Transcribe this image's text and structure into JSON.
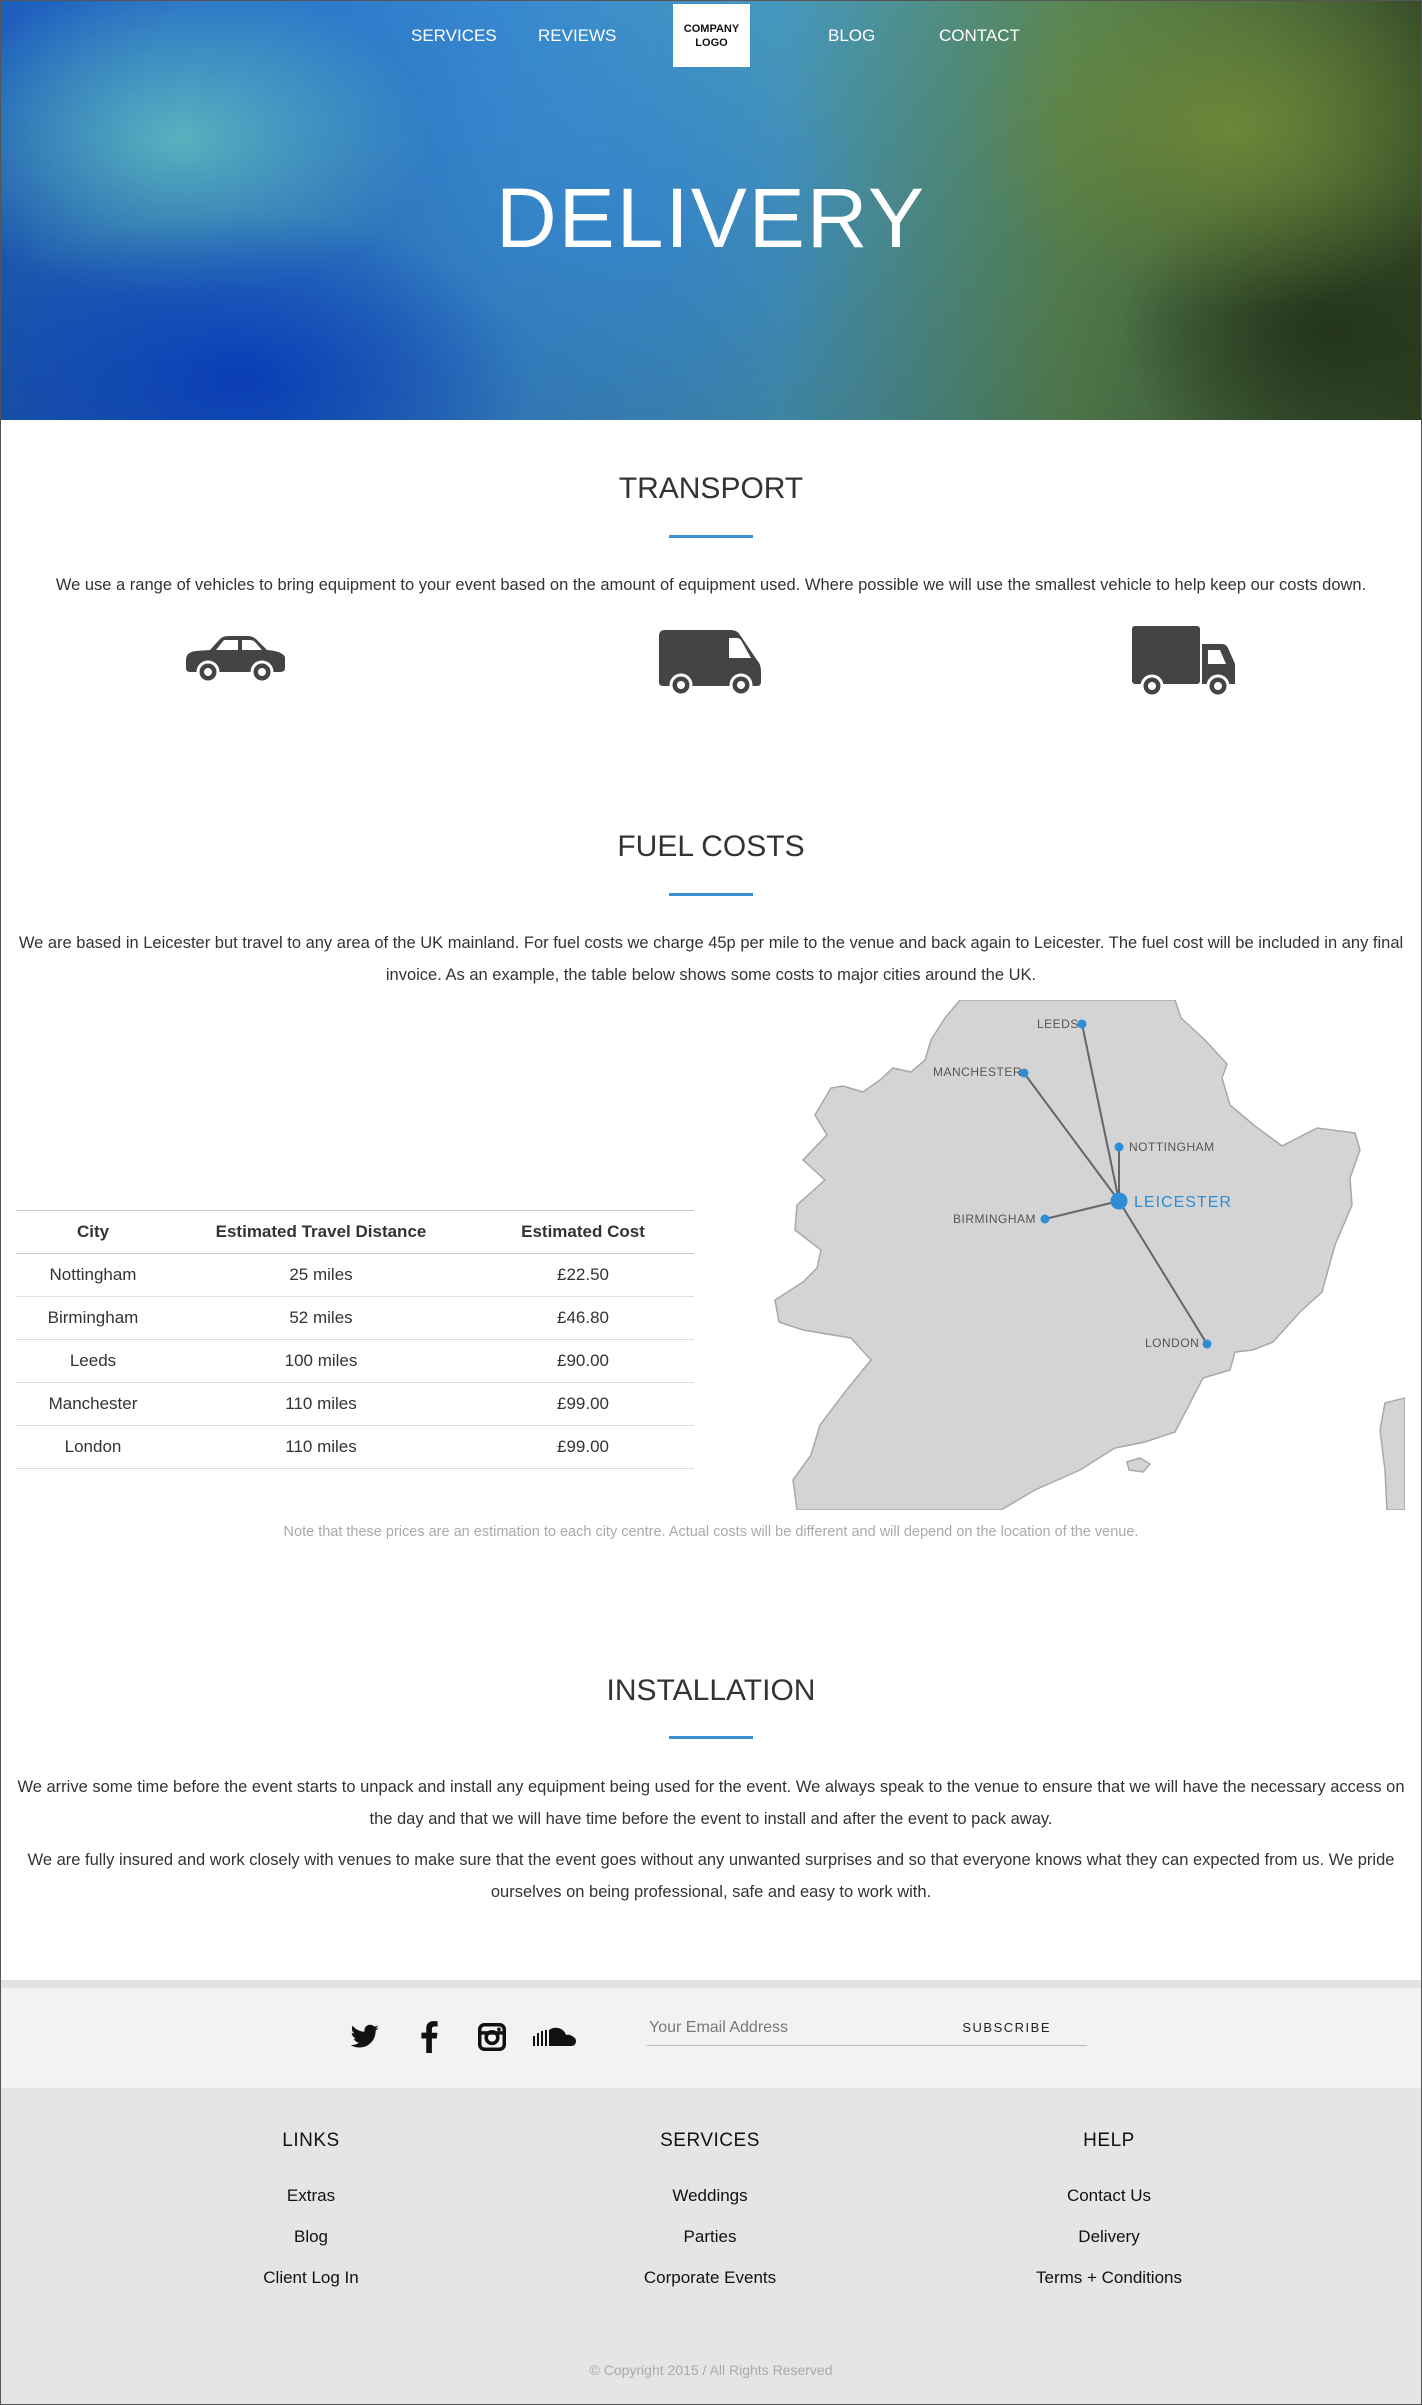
{
  "nav": {
    "services": "SERVICES",
    "reviews": "REVIEWS",
    "logo_line1": "COMPANY",
    "logo_line2": "LOGO",
    "blog": "BLOG",
    "contact": "CONTACT"
  },
  "hero": {
    "title": "DELIVERY"
  },
  "transport": {
    "title": "TRANSPORT",
    "text": "We use a range of vehicles to bring equipment to your event based on the amount of equipment used. Where possible we will use the smallest vehicle to help keep our costs down.",
    "icons": [
      "car-icon",
      "van-icon",
      "truck-icon"
    ]
  },
  "fuel": {
    "title": "FUEL COSTS",
    "text": "We are based in Leicester but travel to any area of the UK mainland. For fuel costs we charge 45p per mile to the venue and back again to Leicester. The fuel cost will be included in any final invoice. As an example, the table below shows some costs to major cities around the UK.",
    "table": {
      "headers": [
        "City",
        "Estimated Travel Distance",
        "Estimated Cost"
      ],
      "rows": [
        [
          "Nottingham",
          "25 miles",
          "£22.50"
        ],
        [
          "Birmingham",
          "52 miles",
          "£46.80"
        ],
        [
          "Leeds",
          "100 miles",
          "£90.00"
        ],
        [
          "Manchester",
          "110 miles",
          "£99.00"
        ],
        [
          "London",
          "110 miles",
          "£99.00"
        ]
      ]
    },
    "map_labels": {
      "leeds": "LEEDS",
      "manchester": "MANCHESTER",
      "nottingham": "NOTTINGHAM",
      "leicester": "LEICESTER",
      "birmingham": "BIRMINGHAM",
      "london": "LONDON"
    },
    "note": "Note that these prices are an estimation to each city centre. Actual costs will be different and will depend on the location of the venue."
  },
  "installation": {
    "title": "INSTALLATION",
    "text1": "We arrive some time before the event starts to unpack and install any equipment being used for the event. We always speak to the venue to ensure that we will have the necessary access on the day and that we will have time before the event to install and after the event to pack away.",
    "text2": "We are fully insured and work closely with venues to make sure that the event goes without any unwanted surprises and so that everyone knows what they can expected from us. We pride ourselves on being professional, safe and easy to work with."
  },
  "subscribe": {
    "email_placeholder": "Your Email Address",
    "button": "SUBSCRIBE",
    "social": [
      "twitter-icon",
      "facebook-icon",
      "instagram-icon",
      "soundcloud-icon"
    ]
  },
  "footer": {
    "links": {
      "title": "LINKS",
      "items": [
        "Extras",
        "Blog",
        "Client Log In"
      ]
    },
    "services": {
      "title": "SERVICES",
      "items": [
        "Weddings",
        "Parties",
        "Corporate Events"
      ]
    },
    "help": {
      "title": "HELP",
      "items": [
        "Contact Us",
        "Delivery",
        "Terms + Conditions"
      ]
    },
    "copyright": "© Copyright 2015 / All Rights Reserved"
  },
  "colors": {
    "accent": "#3b8fd4",
    "map_land": "#d4d4d4",
    "footer_bg": "#e5e5e5"
  }
}
